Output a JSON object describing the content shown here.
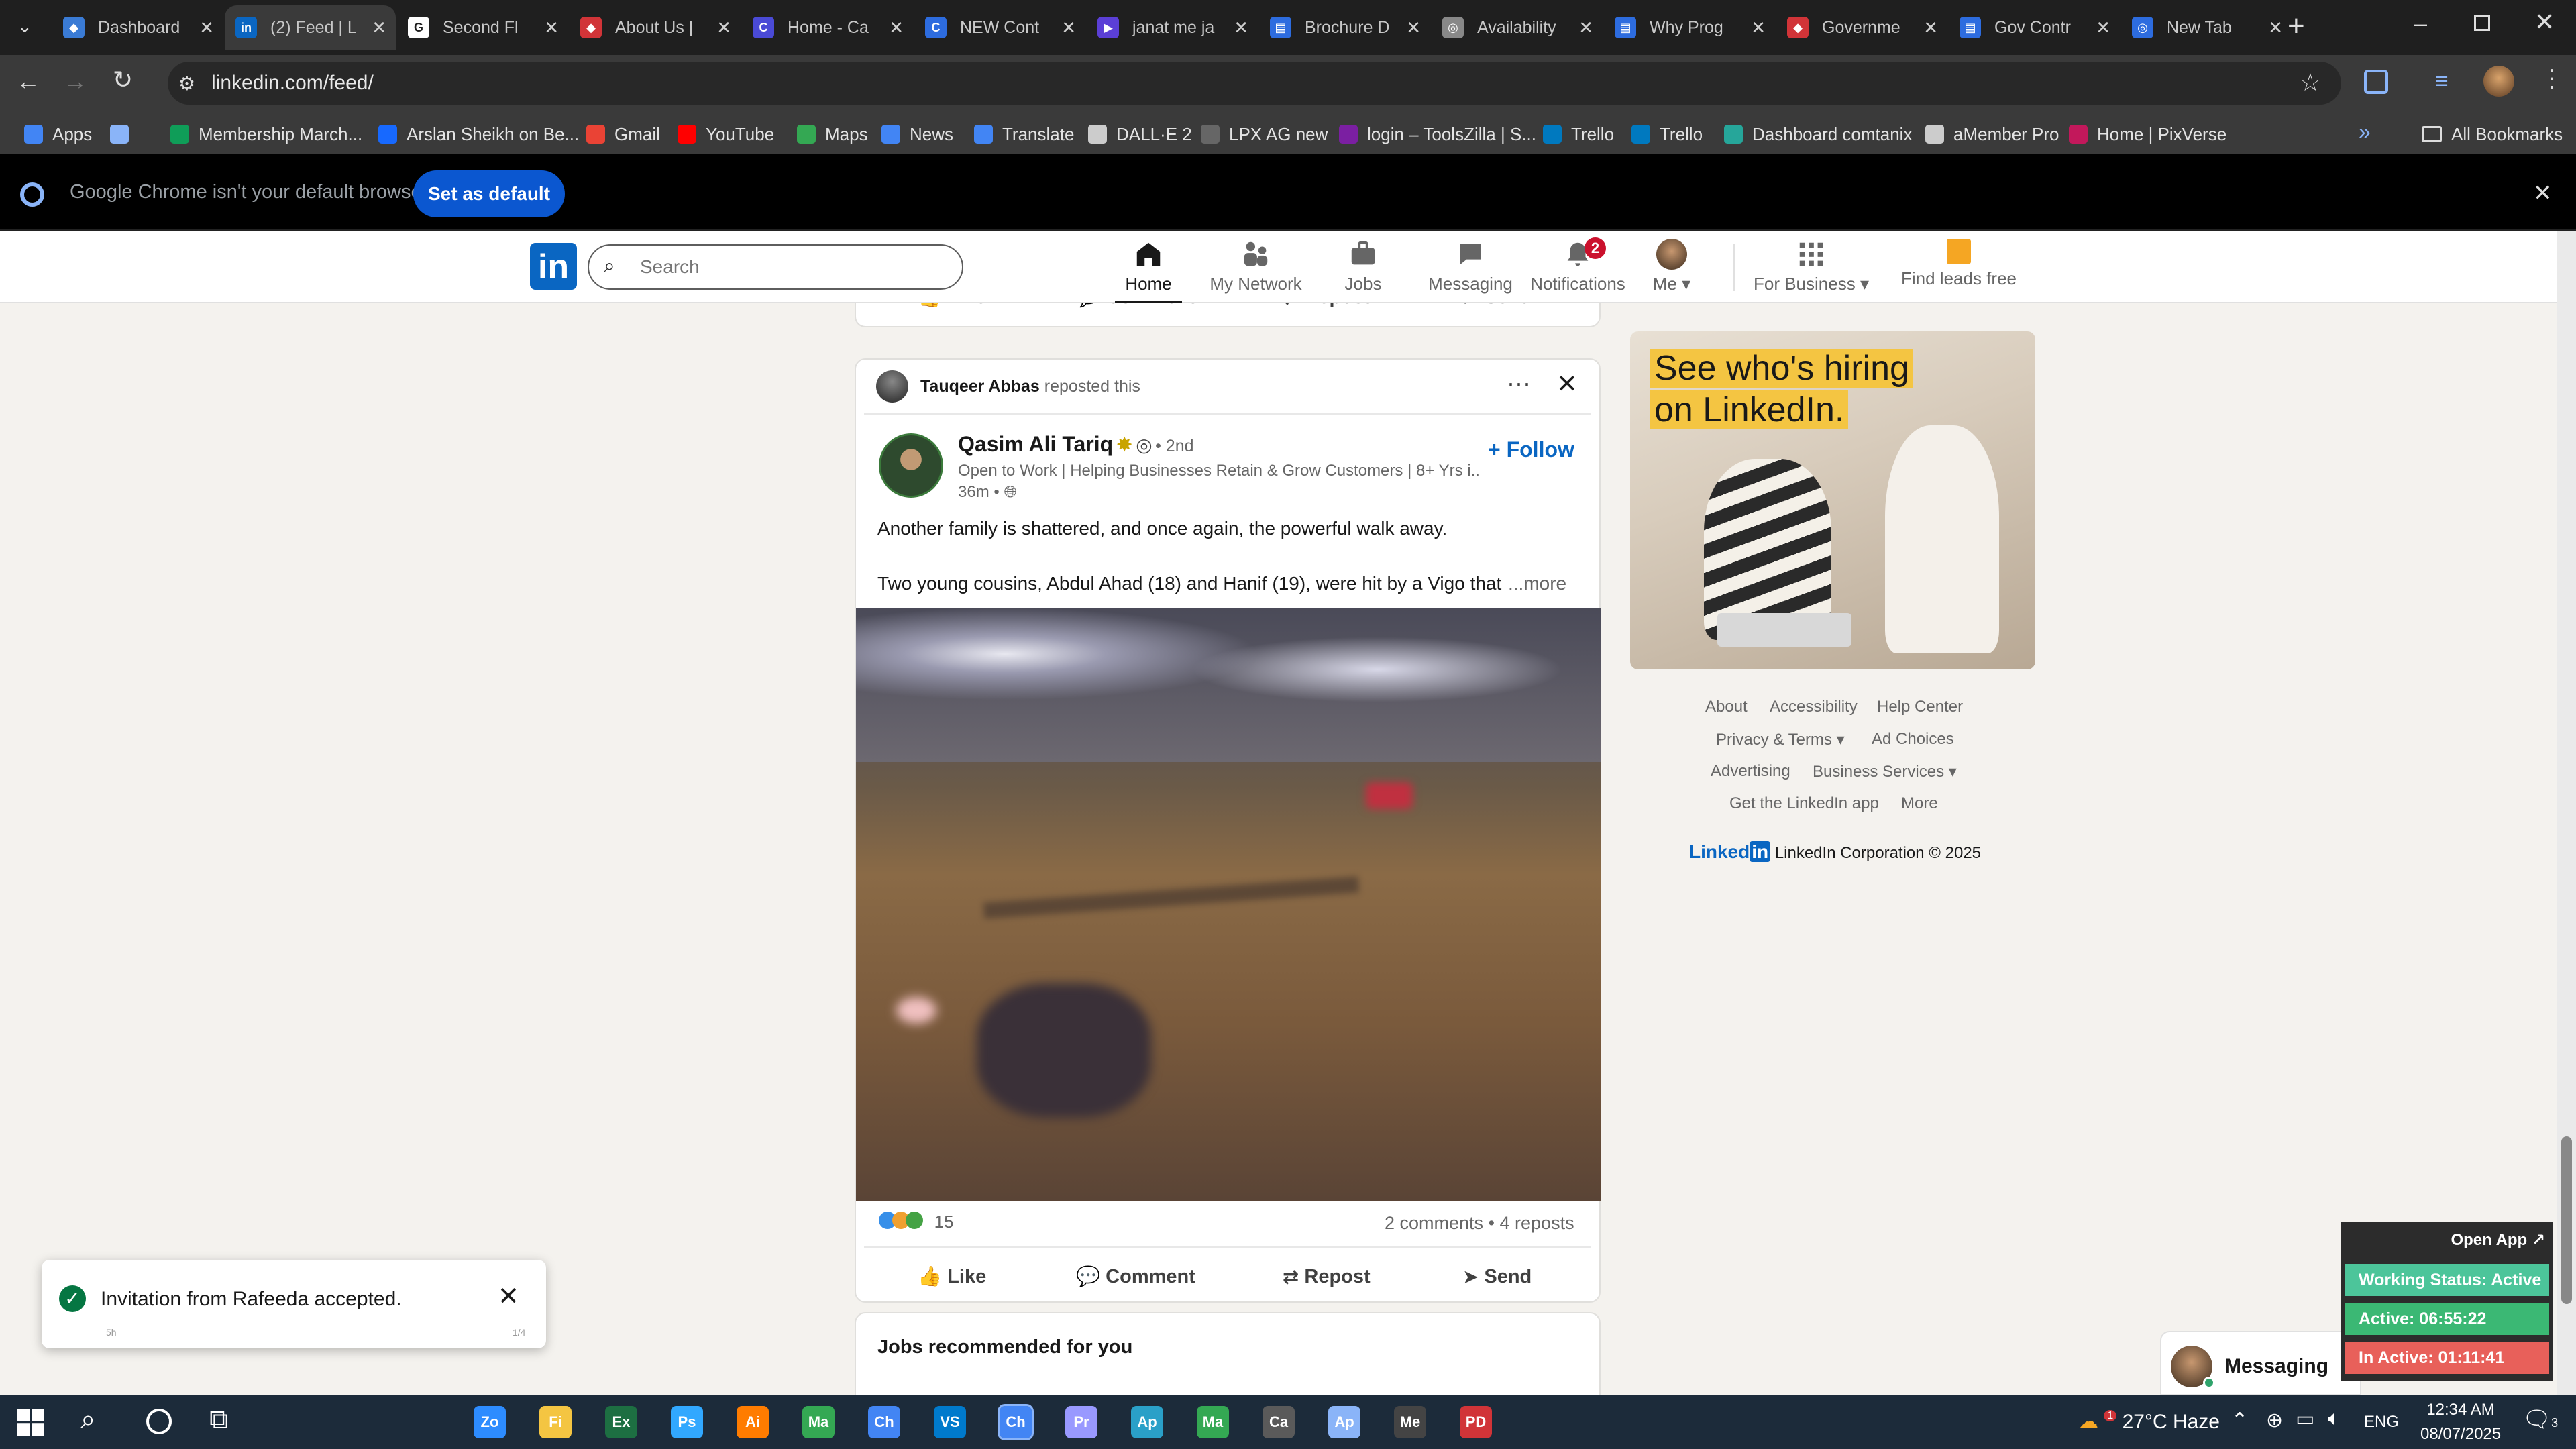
{
  "browser": {
    "tabs": [
      {
        "label": "Dashboard",
        "color": "#3a7bd5",
        "glyph": "◆"
      },
      {
        "label": "(2) Feed | L",
        "color": "#0a66c2",
        "glyph": "in"
      },
      {
        "label": "Second Fl",
        "color": "#ffffff",
        "glyph": "G"
      },
      {
        "label": "About Us |",
        "color": "#d13438",
        "glyph": "◆"
      },
      {
        "label": "Home - Ca",
        "color": "#4a4ad6",
        "glyph": "C"
      },
      {
        "label": "NEW Cont",
        "color": "#2d6cdf",
        "glyph": "C"
      },
      {
        "label": "janat me ja",
        "color": "#5b3fd6",
        "glyph": "▶"
      },
      {
        "label": "Brochure D",
        "color": "#2d6cdf",
        "glyph": "▤"
      },
      {
        "label": "Availability",
        "color": "#888888",
        "glyph": "◎"
      },
      {
        "label": "Why Prog",
        "color": "#2d6cdf",
        "glyph": "▤"
      },
      {
        "label": "Governme",
        "color": "#d13438",
        "glyph": "◆"
      },
      {
        "label": "Gov Contr",
        "color": "#2d6cdf",
        "glyph": "▤"
      },
      {
        "label": "New Tab",
        "color": "#2d6cdf",
        "glyph": "◎"
      }
    ],
    "url": "linkedin.com/feed/",
    "bookmarks": [
      {
        "label": "Apps",
        "color": "#4285f4"
      },
      {
        "label": "",
        "color": "#8ab4f8"
      },
      {
        "label": "Membership March...",
        "color": "#0f9d58"
      },
      {
        "label": "Arslan Sheikh on Be...",
        "color": "#1769ff"
      },
      {
        "label": "Gmail",
        "color": "#ea4335"
      },
      {
        "label": "YouTube",
        "color": "#ff0000"
      },
      {
        "label": "Maps",
        "color": "#34a853"
      },
      {
        "label": "News",
        "color": "#4285f4"
      },
      {
        "label": "Translate",
        "color": "#4285f4"
      },
      {
        "label": "DALL·E 2",
        "color": "#cccccc"
      },
      {
        "label": "LPX AG new",
        "color": "#666666"
      },
      {
        "label": "login – ToolsZilla | S...",
        "color": "#7b1fa2"
      },
      {
        "label": "Trello",
        "color": "#0079bf"
      },
      {
        "label": "Trello",
        "color": "#0079bf"
      },
      {
        "label": "Dashboard comtanix",
        "color": "#26a69a"
      },
      {
        "label": "aMember Pro",
        "color": "#cccccc"
      },
      {
        "label": "Home | PixVerse",
        "color": "#c2185b"
      }
    ],
    "all_bookmarks": "All Bookmarks",
    "default_message": "Google Chrome isn't your default browser",
    "set_default": "Set as default"
  },
  "linkedin": {
    "search_placeholder": "Search",
    "nav": {
      "home": "Home",
      "network": "My Network",
      "jobs": "Jobs",
      "messaging": "Messaging",
      "notifications": "Notifications",
      "notifications_count": "2",
      "me": "Me",
      "business": "For Business",
      "leads": "Find leads free"
    },
    "actions": {
      "like": "Like",
      "comment": "Comment",
      "repost": "Repost",
      "send": "Send"
    },
    "post": {
      "reposter": "Tauqeer Abbas",
      "reposted_text": "reposted this",
      "author": "Qasim Ali Tariq",
      "degree": "• 2nd",
      "headline": "Open to Work | Helping Businesses Retain & Grow Customers | 8+ Yrs i...",
      "time": "36m •",
      "follow": "+ Follow",
      "text1": "Another family is shattered, and once again, the powerful walk away.",
      "text2": "Two young cousins, Abdul Ahad (18) and Hanif (19), were hit by a Vigo that",
      "more": "...more",
      "reactions": "15",
      "stats": "2 comments • 4 reposts"
    },
    "jobs_title": "Jobs recommended for you",
    "ad": {
      "line1": "See who's hiring",
      "line2": "on LinkedIn."
    },
    "footer": {
      "about": "About",
      "accessibility": "Accessibility",
      "help": "Help Center",
      "privacy": "Privacy & Terms",
      "adchoices": "Ad Choices",
      "advertising": "Advertising",
      "business_services": "Business Services",
      "app": "Get the LinkedIn app",
      "more": "More",
      "brand": "Linked",
      "copyright": "LinkedIn Corporation © 2025"
    },
    "messaging_label": "Messaging"
  },
  "toast": {
    "message": "Invitation from Rafeeda accepted.",
    "time": "5h",
    "page": "1/4"
  },
  "widget": {
    "open_app": "Open App ↗",
    "status": "Working Status: Active",
    "active": "Active: 06:55:22",
    "inactive": "In Active: 01:11:41"
  },
  "taskbar": {
    "weather": "27°C Haze",
    "weather_badge": "1",
    "lang": "ENG",
    "time": "12:34 AM",
    "date": "08/07/2025",
    "notif_count": "3",
    "apps": [
      "Zoom",
      "Files",
      "Excel",
      "Ps",
      "Ai",
      "Maps",
      "Chrome",
      "VS Code",
      "Chrome",
      "Pr",
      "App",
      "Maps",
      "Calc",
      "App",
      "Media",
      "PDF"
    ]
  }
}
